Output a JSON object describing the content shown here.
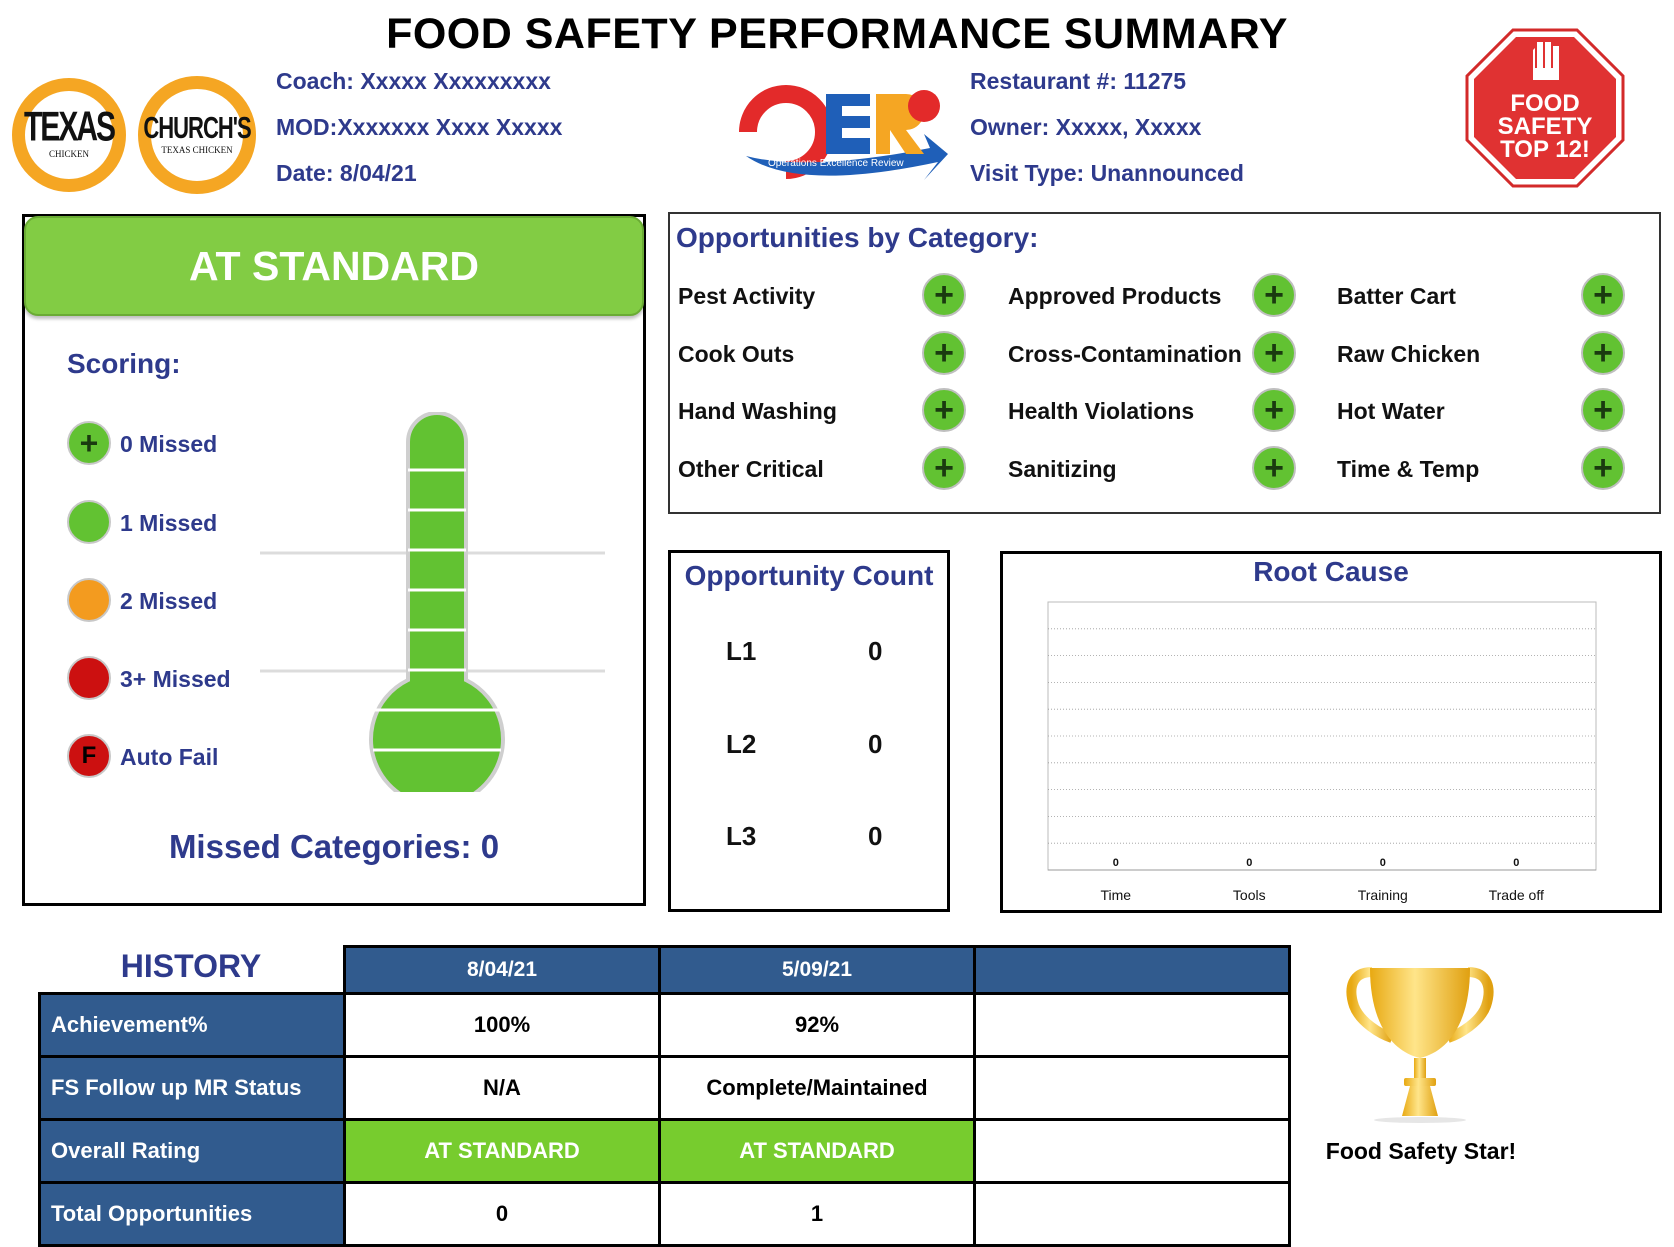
{
  "header": {
    "title": "FOOD SAFETY PERFORMANCE SUMMARY",
    "coach": "Coach: Xxxxx Xxxxxxxxx",
    "mod": "MOD:Xxxxxxx Xxxx Xxxxx",
    "date": "Date: 8/04/21",
    "restaurant": "Restaurant #: 11275",
    "owner": "Owner: Xxxxx, Xxxxx",
    "visit_type": "Visit Type: Unannounced"
  },
  "logos": {
    "texas": {
      "word": "TEXAS",
      "sub": "CHICKEN"
    },
    "churchs": {
      "word": "CHURCH'S",
      "sub": "TEXAS CHICKEN"
    },
    "oer": {
      "letters": "OER",
      "tagline": "Operations Excellence Review",
      "badge": "Church's"
    },
    "food_safety": {
      "line1": "FOOD",
      "line2": "SAFETY",
      "line3": "TOP 12!"
    },
    "colors": {
      "orange": "#f5a623",
      "red": "#e03232",
      "blue": "#1f5fb8"
    }
  },
  "status": {
    "label": "AT STANDARD",
    "color": "#82cc44"
  },
  "scoring": {
    "title": "Scoring:",
    "legend": [
      {
        "label": "0 Missed",
        "icon": "plus-icon",
        "color": "#62c232"
      },
      {
        "label": "1 Missed",
        "icon": "green-dot",
        "color": "#62c232"
      },
      {
        "label": "2 Missed",
        "icon": "orange-dot",
        "color": "#f39b1f"
      },
      {
        "label": "3+ Missed",
        "icon": "red-dot",
        "color": "#cc1010"
      },
      {
        "label": "Auto Fail",
        "icon": "auto-fail-icon",
        "symbol": "F",
        "color": "#cc1010"
      }
    ],
    "missed_categories": "Missed Categories: 0",
    "thermometer_fill": 1.0
  },
  "categories": {
    "title": "Opportunities by Category:",
    "items": [
      "Pest Activity",
      "Approved Products",
      "Batter Cart",
      "Cook Outs",
      "Cross-Contamination",
      "Raw Chicken",
      "Hand Washing",
      "Health Violations",
      "Hot Water",
      "Other Critical",
      "Sanitizing",
      "Time & Temp"
    ],
    "status_symbol": "+"
  },
  "opportunity_count": {
    "title": "Opportunity Count",
    "rows": [
      {
        "level": "L1",
        "count": "0"
      },
      {
        "level": "L2",
        "count": "0"
      },
      {
        "level": "L3",
        "count": "0"
      }
    ]
  },
  "chart_data": {
    "type": "bar",
    "title": "Root Cause",
    "categories": [
      "Time",
      "Tools",
      "Training",
      "Trade off"
    ],
    "values": [
      0,
      0,
      0,
      0
    ],
    "data_labels": [
      "0",
      "0",
      "0",
      "0"
    ],
    "grid": true,
    "ylim": [
      0,
      10
    ]
  },
  "history": {
    "title": "HISTORY",
    "columns": [
      "8/04/21",
      "5/09/21",
      ""
    ],
    "rows": [
      {
        "label": "Achievement%",
        "values": [
          "100%",
          "92%",
          ""
        ]
      },
      {
        "label": "FS Follow up MR Status",
        "values": [
          "N/A",
          "Complete/Maintained",
          ""
        ]
      },
      {
        "label": "Overall Rating",
        "values": [
          "AT STANDARD",
          "AT STANDARD",
          ""
        ]
      },
      {
        "label": "Total Opportunities",
        "values": [
          "0",
          "1",
          ""
        ]
      }
    ]
  },
  "trophy": {
    "caption": "Food Safety Star!",
    "color": "#f2c12e"
  }
}
